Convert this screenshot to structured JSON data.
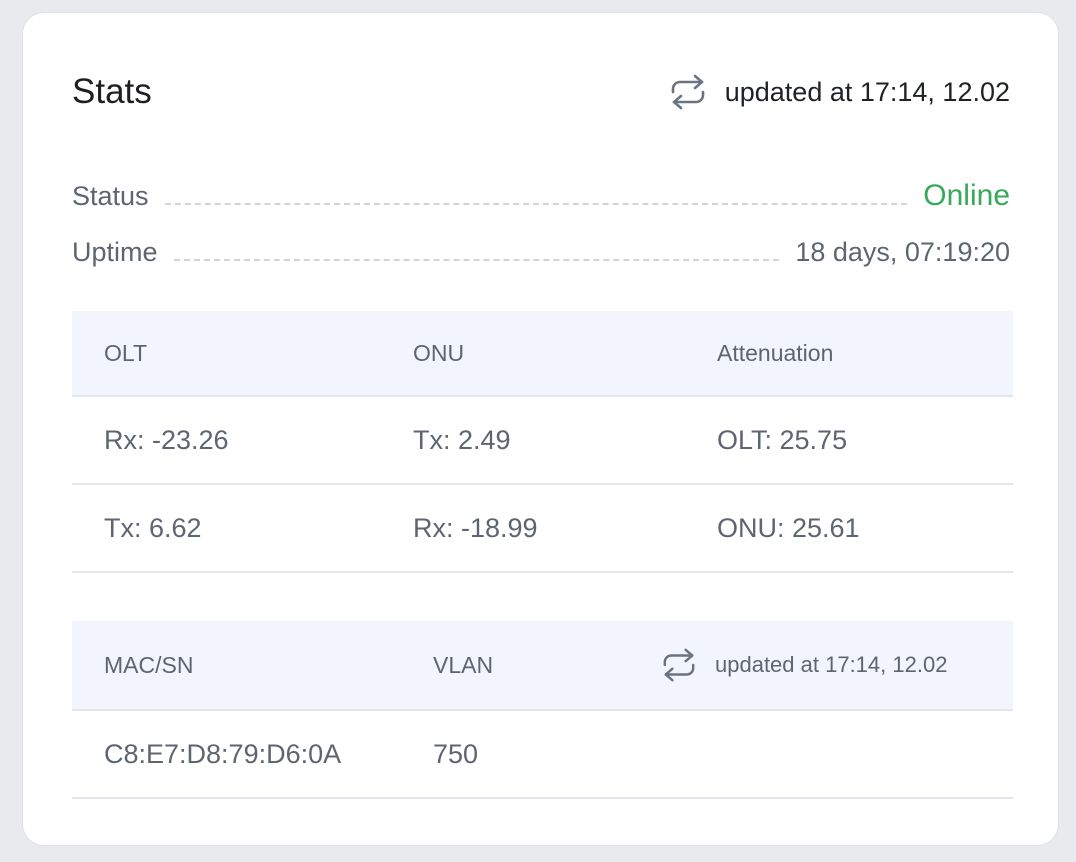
{
  "card": {
    "title": "Stats",
    "updated_text": "updated at 17:14, 12.02"
  },
  "status": {
    "label": "Status",
    "value": "Online",
    "value_color": "#37a95a"
  },
  "uptime": {
    "label": "Uptime",
    "value": "18 days, 07:19:20"
  },
  "signal_table": {
    "headers": [
      "OLT",
      "ONU",
      "Attenuation"
    ],
    "rows": [
      [
        "Rx: -23.26",
        "Tx: 2.49",
        "OLT: 25.75"
      ],
      [
        "Tx: 6.62",
        "Rx: -18.99",
        "ONU: 25.61"
      ]
    ]
  },
  "device_table": {
    "headers": [
      "MAC/SN",
      "VLAN"
    ],
    "updated_text": "updated at 17:14, 12.02",
    "rows": [
      [
        "C8:E7:D8:79:D6:0A",
        "750"
      ]
    ]
  },
  "icons": {
    "refresh": "refresh-icon"
  }
}
